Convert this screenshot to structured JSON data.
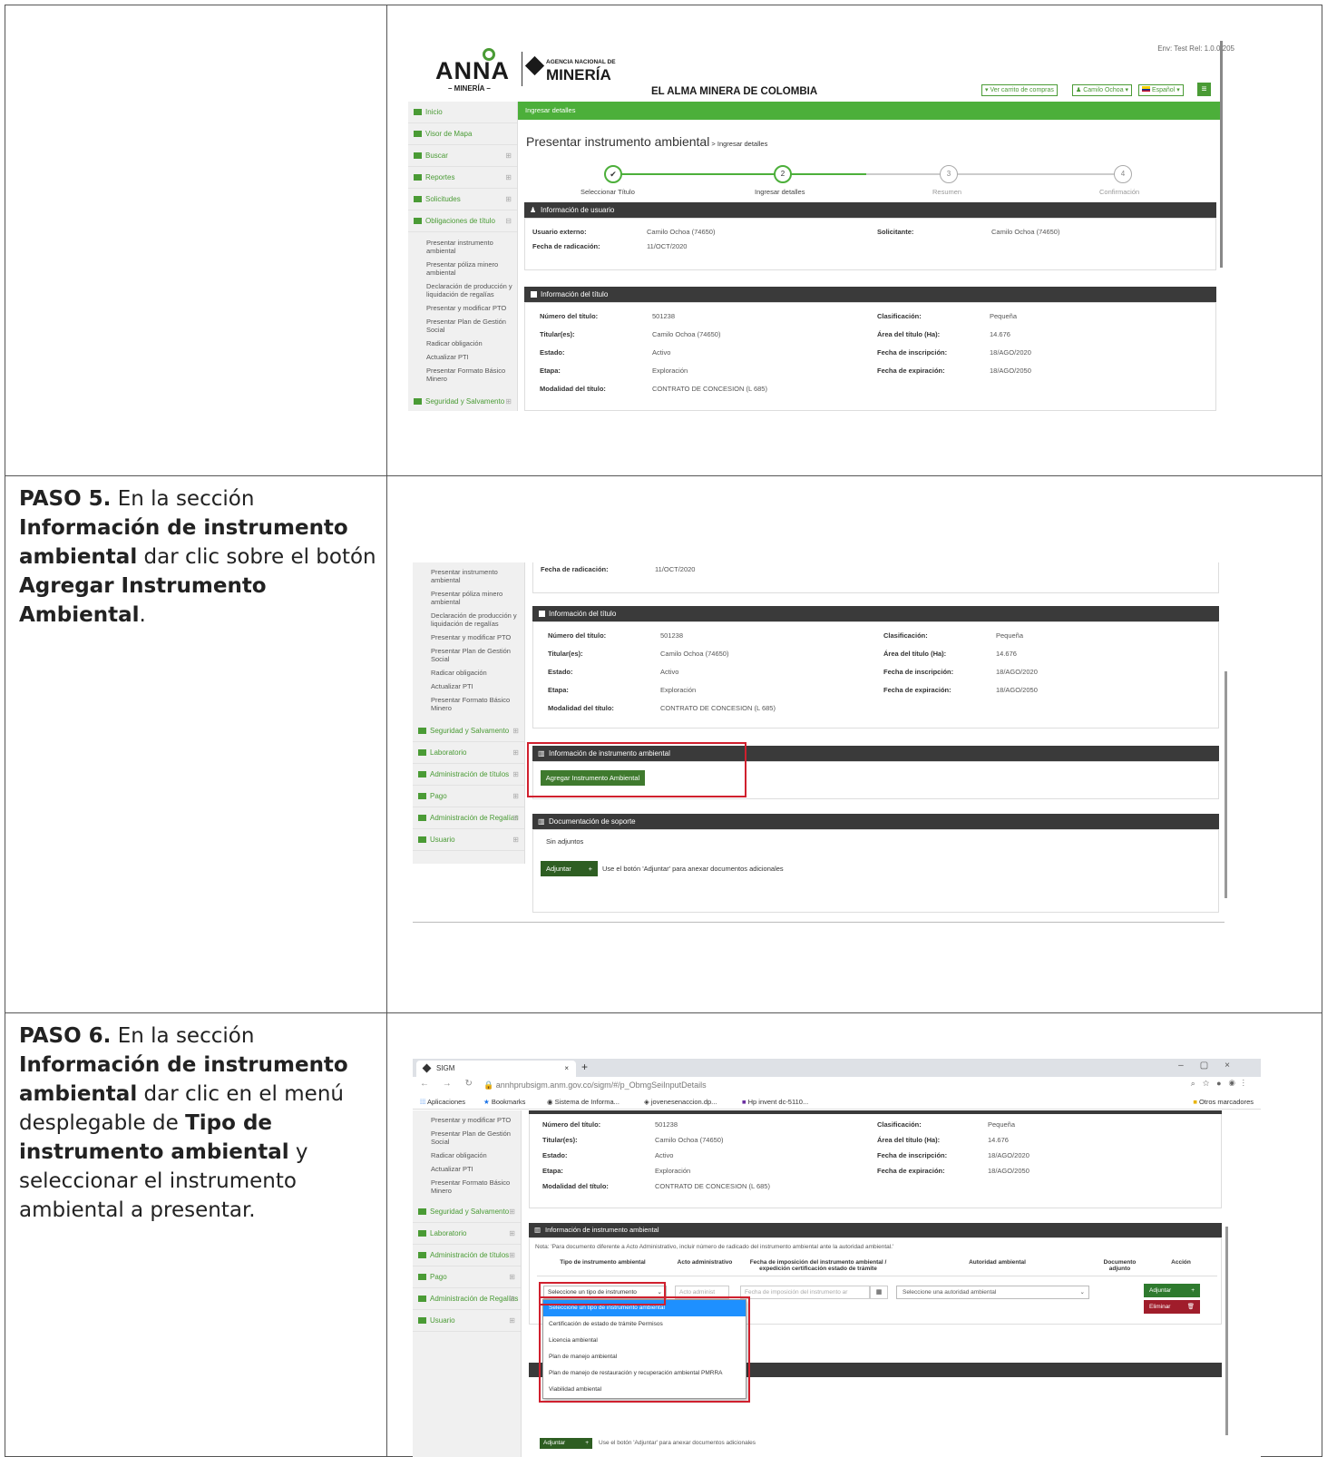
{
  "step5": {
    "title": "PASO 5.",
    "t1": " En la sección ",
    "b1": "Información de instrumento ambiental",
    "t2": " dar clic sobre el botón ",
    "b2": "Agregar Instrumento Ambiental",
    "t3": "."
  },
  "step6": {
    "title": "PASO 6.",
    "t1": " En la sección ",
    "b1": "Información de instrumento ambiental",
    "t2": " dar clic en el menú desplegable de ",
    "b2": "Tipo de instrumento ambiental",
    "t3": " y seleccionar el instrumento ambiental a presentar."
  },
  "header": {
    "env": "Env: Test Rel: 1.0.0.205",
    "anna_logo": "ANNA",
    "anna_sub": "– MINERÍA –",
    "agency_small": "AGENCIA NACIONAL DE",
    "agency_big": "MINERÍA",
    "slogan": "EL ALMA MINERA DE COLOMBIA",
    "cart": "Ver carrito de compras",
    "user": "Camilo Ochoa",
    "lang": "Español"
  },
  "green_bar": "Ingresar detalles",
  "page_title": "Presentar instrumento ambiental",
  "page_sub": " > Ingresar detalles",
  "steps": [
    {
      "n": "✔",
      "label": "Seleccionar Título"
    },
    {
      "n": "2",
      "label": "Ingresar detalles"
    },
    {
      "n": "3",
      "label": "Resumen"
    },
    {
      "n": "4",
      "label": "Confirmación"
    }
  ],
  "sidebar": {
    "inicio": "Inicio",
    "visor": "Visor de Mapa",
    "buscar": "Buscar",
    "reportes": "Reportes",
    "solicitudes": "Solicitudes",
    "obligaciones": "Obligaciones de título",
    "sub": [
      "Presentar instrumento ambiental",
      "Presentar póliza minero ambiental",
      "Declaración de producción y liquidación de regalías",
      "Presentar y modificar PTO",
      "Presentar Plan de Gestión Social",
      "Radicar obligación",
      "Actualizar PTI",
      "Presentar Formato Básico Minero"
    ],
    "seguridad": "Seguridad y Salvamento",
    "laboratorio": "Laboratorio",
    "admin_titulos": "Administración de títulos",
    "pago": "Pago",
    "admin_regalias": "Administración de Regalías",
    "usuario": "Usuario"
  },
  "user_info": {
    "title": "Información de usuario",
    "usuario_externo_l": "Usuario externo:",
    "usuario_externo_v": "Camilo Ochoa (74650)",
    "fecha_l": "Fecha de radicación:",
    "fecha_v": "11/OCT/2020",
    "solicitante_l": "Solicitante:",
    "solicitante_v": "Camilo Ochoa (74650)"
  },
  "title_info": {
    "title": "Información del título",
    "numero_l": "Número del título:",
    "numero_v": "501238",
    "titular_l": "Titular(es):",
    "titular_v": "Camilo Ochoa (74650)",
    "estado_l": "Estado:",
    "estado_v": "Activo",
    "etapa_l": "Etapa:",
    "etapa_v": "Exploración",
    "modalidad_l": "Modalidad del título:",
    "modalidad_v": "CONTRATO DE CONCESION (L 685)",
    "clasif_l": "Clasificación:",
    "clasif_v": "Pequeña",
    "area_l": "Área del título (Ha):",
    "area_v": "14.676",
    "insc_l": "Fecha de inscripción:",
    "insc_v": "18/AGO/2020",
    "exp_l": "Fecha de expiración:",
    "exp_v": "18/AGO/2050"
  },
  "instrumento": {
    "title": "Información de instrumento ambiental",
    "button": "Agregar Instrumento Ambiental",
    "nota": "Nota: 'Para documento diferente a Acto Administrativo, incluir número de radicado del instrumento ambiental ante la autoridad ambiental.'",
    "col_tipo": "Tipo de instrumento ambiental",
    "col_acto": "Acto administrativo",
    "col_fecha": "Fecha de imposición del instrumento ambiental / expedición certificación estado de trámite",
    "col_autoridad": "Autoridad ambiental",
    "col_doc": "Documento adjunto",
    "col_accion": "Acción",
    "select_tipo": "Seleccione un tipo de instrumento",
    "ph_acto": "Acto administ",
    "ph_fecha": "Fecha de imposición del instrumento ar",
    "select_autoridad": "Seleccione una autoridad ambiental",
    "adjuntar": "Adjuntar",
    "eliminar": "Eliminar",
    "options": [
      "Seleccione un tipo de instrumento ambiental",
      "Certificación de estado de trámite Permisos",
      "Licencia ambiental",
      "Plan de manejo ambiental",
      "Plan de manejo de restauración y recuperación ambiental PMRRA",
      "Viabilidad ambiental"
    ]
  },
  "soporte": {
    "title": "Documentación de soporte",
    "sin": "Sin adjuntos",
    "adjuntar": "Adjuntar",
    "help": "Use el botón 'Adjuntar' para anexar documentos adicionales"
  },
  "browser": {
    "tab": "SIGM",
    "url": "annhprubsigm.anm.gov.co/sigm/#/p_ObmgSeiInputDetails",
    "bm_apps": "Aplicaciones",
    "bm_1": "Bookmarks",
    "bm_2": "Sistema de Informa...",
    "bm_3": "jovenesenaccion.dp...",
    "bm_4": "Hp invent dc-5110...",
    "bm_other": "Otros marcadores"
  }
}
